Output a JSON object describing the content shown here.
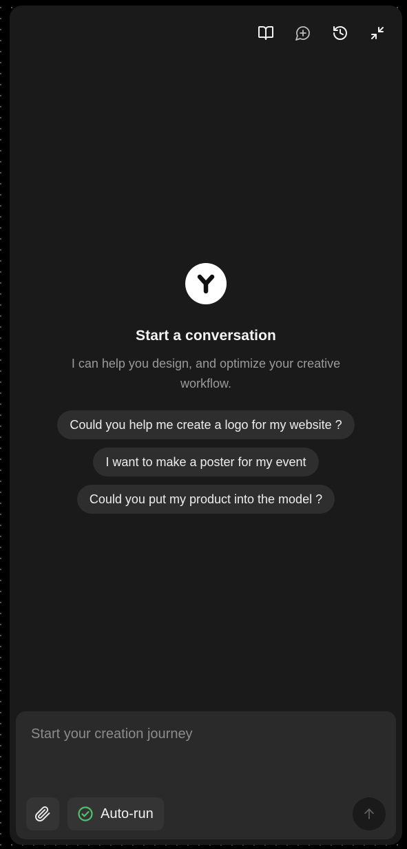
{
  "toolbar": {
    "icons": [
      "book-icon",
      "add-chat-icon",
      "history-icon",
      "collapse-icon"
    ]
  },
  "welcome": {
    "title": "Start a conversation",
    "subtitle": "I can help you design, and optimize your creative workflow."
  },
  "suggestions": [
    "Could you help me create a logo for my website ?",
    "I want to make a poster for my event",
    "Could you put my product into the model ?"
  ],
  "composer": {
    "placeholder": "Start your creation journey",
    "value": "",
    "autorun_label": "Auto-run",
    "autorun_enabled": true,
    "accent_color": "#4cc26a"
  }
}
